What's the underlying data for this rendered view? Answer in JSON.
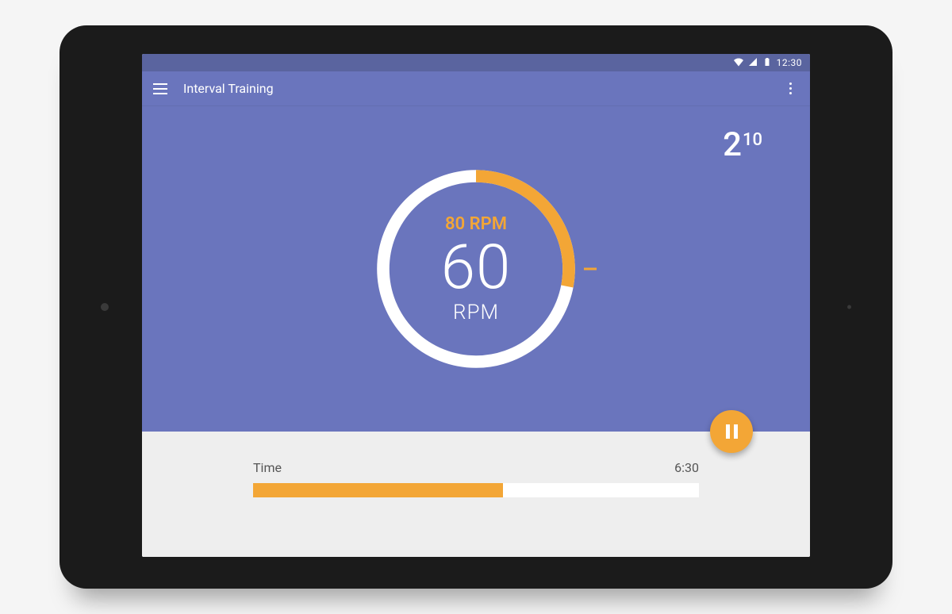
{
  "status": {
    "clock": "12:30"
  },
  "appbar": {
    "title": "Interval Training"
  },
  "gauge": {
    "target_label": "80 RPM",
    "current_value": "60",
    "current_unit": "RPM",
    "progress_percent": 28
  },
  "timer": {
    "minutes": "2",
    "seconds": "10"
  },
  "bottom": {
    "label": "Time",
    "value": "6:30",
    "progress_percent": 56
  },
  "colors": {
    "primary": "#6a75bd",
    "primary_dark": "#5a649f",
    "accent": "#f3a636",
    "surface": "#eeeeee"
  }
}
